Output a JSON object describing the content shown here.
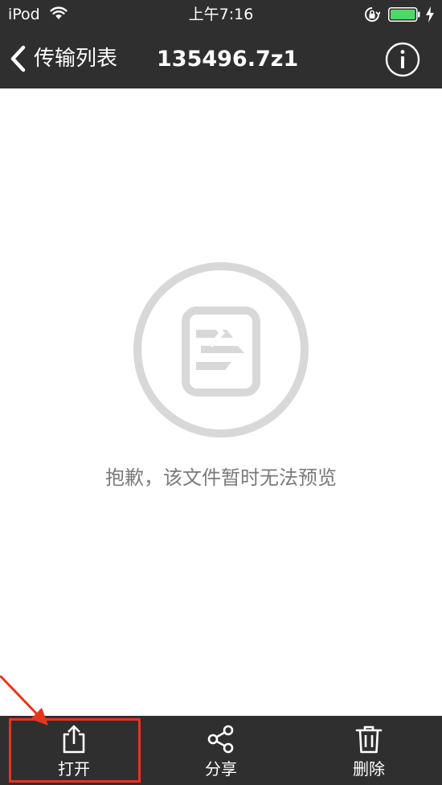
{
  "status_bar": {
    "carrier": "iPod",
    "time": "上午7:16",
    "battery_color": "#4cd964"
  },
  "nav": {
    "back_label": "传输列表",
    "title": "135496.7z1",
    "info_icon": "info-icon"
  },
  "content": {
    "icon": "file-unsupported-icon",
    "message": "抱歉，该文件暂时无法预览"
  },
  "toolbar": {
    "open_label": "打开",
    "share_label": "分享",
    "delete_label": "删除"
  },
  "annotation": {
    "color": "#e8341c"
  }
}
